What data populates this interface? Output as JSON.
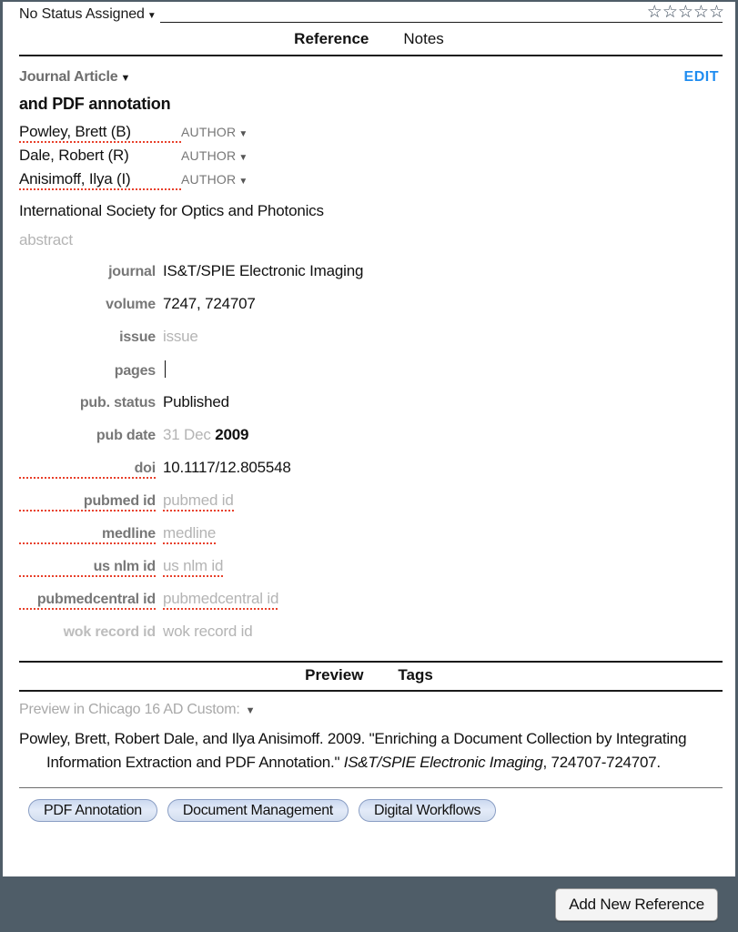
{
  "window": {
    "footer_bg": "#4f5d68",
    "accent_blue": "#1f8cf0"
  },
  "status_bar": {
    "status_label": "No Status Assigned",
    "caret": "▼",
    "rating_stars": [
      "☆",
      "☆",
      "☆",
      "☆",
      "☆"
    ],
    "rating_value": 0
  },
  "top_tabs": [
    {
      "label": "Reference",
      "active": true
    },
    {
      "label": "Notes",
      "active": false
    }
  ],
  "reference": {
    "type_label": "Journal Article",
    "type_caret": "▼",
    "edit_label": "EDIT",
    "title": "and PDF annotation",
    "authors": [
      {
        "name": "Powley, Brett (B)",
        "role": "AUTHOR",
        "role_caret": "▼",
        "misspelled": true
      },
      {
        "name": "Dale, Robert (R)",
        "role": "AUTHOR",
        "role_caret": "▼",
        "misspelled": false
      },
      {
        "name": "Anisimoff, Ilya (I)",
        "role": "AUTHOR",
        "role_caret": "▼",
        "misspelled": true
      }
    ],
    "publisher": "International Society for Optics and Photonics",
    "abstract_placeholder": "abstract",
    "fields": [
      {
        "label": "journal",
        "value": "IS&T/SPIE Electronic Imaging",
        "is_placeholder": false,
        "label_faded": false,
        "label_misspelled": false,
        "value_misspelled": false
      },
      {
        "label": "volume",
        "value": "7247, 724707",
        "is_placeholder": false,
        "label_faded": false,
        "label_misspelled": false,
        "value_misspelled": false
      },
      {
        "label": "issue",
        "value": "issue",
        "is_placeholder": true,
        "label_faded": false,
        "label_misspelled": false,
        "value_misspelled": false
      },
      {
        "label": "pages",
        "value": "",
        "is_placeholder": false,
        "label_faded": false,
        "label_misspelled": false,
        "value_misspelled": false,
        "has_cursor": true
      },
      {
        "label": "pub. status",
        "value": "Published",
        "is_placeholder": false,
        "label_faded": false,
        "label_misspelled": false,
        "value_misspelled": false
      },
      {
        "label": "pub date",
        "value_placeholder": "31 Dec ",
        "value_strong": "2009",
        "is_partial": true,
        "label_faded": false,
        "label_misspelled": false
      },
      {
        "label": "doi",
        "value": "10.1117/12.805548",
        "is_placeholder": false,
        "label_faded": false,
        "label_misspelled": true,
        "value_misspelled": false
      },
      {
        "label": "pubmed id",
        "value": "pubmed id",
        "is_placeholder": true,
        "label_faded": false,
        "label_misspelled": true,
        "value_misspelled": true
      },
      {
        "label": "medline",
        "value": "medline",
        "is_placeholder": true,
        "label_faded": false,
        "label_misspelled": true,
        "value_misspelled": true
      },
      {
        "label": "us nlm id",
        "value": "us nlm id",
        "is_placeholder": true,
        "label_faded": false,
        "label_misspelled": true,
        "value_misspelled": true
      },
      {
        "label": "pubmedcentral id",
        "value": "pubmedcentral id",
        "is_placeholder": true,
        "label_faded": false,
        "label_misspelled": true,
        "value_misspelled": true
      },
      {
        "label": "wok record id",
        "value": "wok record id",
        "is_placeholder": true,
        "label_faded": true,
        "label_misspelled": false,
        "value_misspelled": false
      }
    ]
  },
  "bottom_tabs": [
    {
      "label": "Preview",
      "active": true
    },
    {
      "label": "Tags",
      "active": true
    }
  ],
  "preview": {
    "style_label": "Preview in Chicago 16 AD Custom:",
    "style_caret": "▼",
    "citation_part1": "Powley, Brett, Robert Dale, and Ilya Anisimoff. 2009. \"Enriching a Document Collection by Integrating Information Extraction and PDF Annotation.\" ",
    "citation_italic": "IS&T/SPIE Electronic Imaging",
    "citation_part2": ", 724707-724707."
  },
  "tags": [
    {
      "label": "PDF Annotation"
    },
    {
      "label": "Document Management"
    },
    {
      "label": "Digital Workflows"
    }
  ],
  "footer": {
    "add_button_label": "Add New Reference"
  }
}
